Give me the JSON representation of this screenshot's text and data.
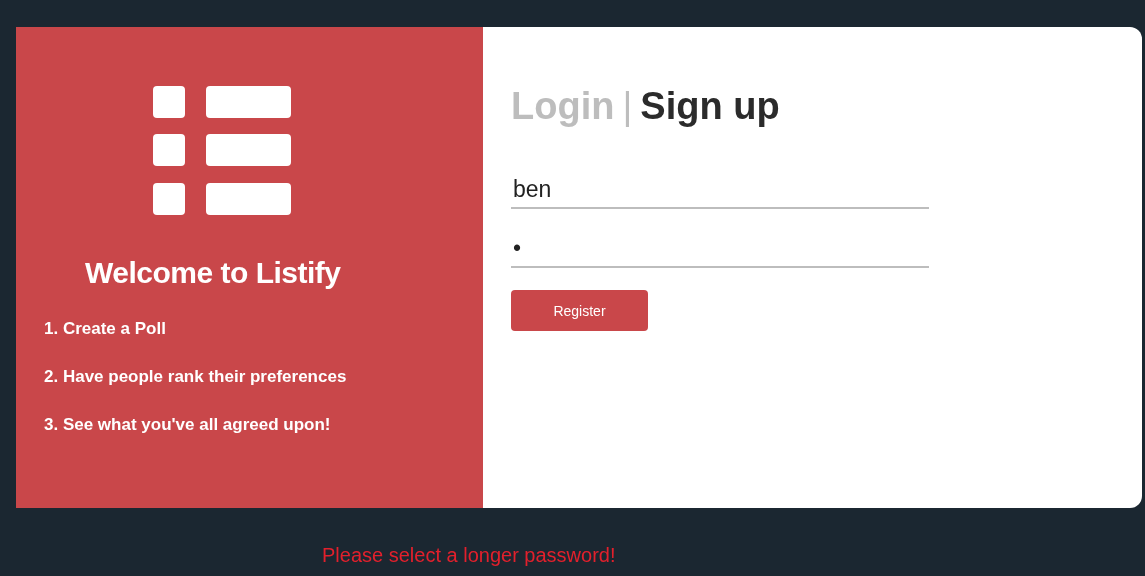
{
  "intro": {
    "title": "Welcome to Listify",
    "steps": [
      "1. Create a Poll",
      "2. Have people rank their preferences",
      "3. See what you've all agreed upon!"
    ]
  },
  "tabs": [
    {
      "label": "Login",
      "selected": false
    },
    {
      "label": "Sign up",
      "selected": true
    }
  ],
  "tab_separator": "|",
  "fields": [
    {
      "value": "ben"
    },
    {
      "value": "•"
    }
  ],
  "submit": {
    "label": "Register"
  },
  "error": "Please select a longer password!"
}
